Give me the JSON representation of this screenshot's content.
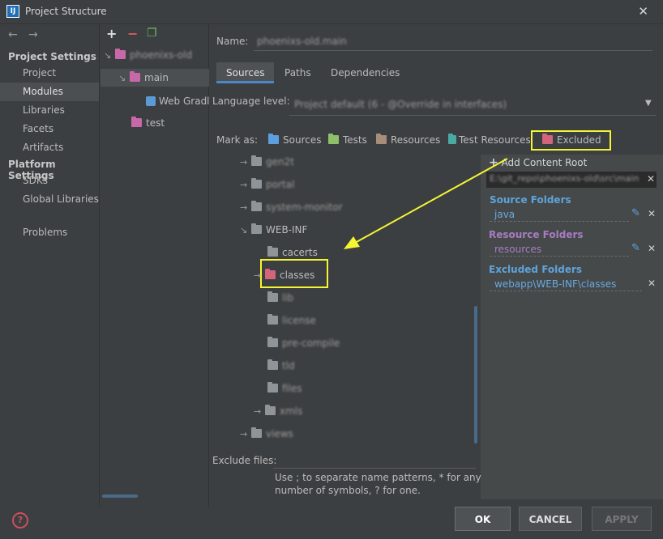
{
  "window": {
    "title": "Project Structure",
    "close_glyph": "✕",
    "icon_letter": "IJ"
  },
  "nav": {
    "back": "←",
    "forward": "→",
    "project_settings_header": "Project Settings",
    "project_items": [
      "Project",
      "Modules",
      "Libraries",
      "Facets",
      "Artifacts"
    ],
    "platform_settings_header": "Platform Settings",
    "platform_items": [
      "SDKs",
      "Global Libraries"
    ],
    "problems": "Problems"
  },
  "module_toolbar": {
    "add": "+",
    "remove": "−",
    "copy": "❐"
  },
  "module_tree": {
    "root": "phoenixs-old",
    "main": "main",
    "web_gradle": "Web Gradl",
    "test": "test"
  },
  "main": {
    "name_label": "Name:",
    "name_value": "phoenixs-old.main",
    "tabs": [
      "Sources",
      "Paths",
      "Dependencies"
    ],
    "language_level_label": "Language level:",
    "language_level_value": "Project default (6 - @Override in interfaces)",
    "mark_as_label": "Mark as:",
    "mark_as": [
      "Sources",
      "Tests",
      "Resources",
      "Test Resources",
      "Excluded"
    ],
    "dirs": [
      "gen2t",
      "portal",
      "system-monitor",
      "WEB-INF",
      "cacerts",
      "classes",
      "lib",
      "license",
      "pre-compile",
      "tld",
      "files",
      "xmls",
      "views"
    ],
    "exclude_files_label": "Exclude files:",
    "exclude_hint_1": "Use ; to separate name patterns, * for any",
    "exclude_hint_2": "number of symbols, ? for one."
  },
  "roots_panel": {
    "add_content_root": "Add Content Root",
    "content_root_path": "E:\\git_repo\\phoenixs-old\\src\\main",
    "source_folders_header": "Source Folders",
    "source_folders": [
      "java"
    ],
    "resource_folders_header": "Resource Folders",
    "resource_folders": [
      "resources"
    ],
    "excluded_folders_header": "Excluded Folders",
    "excluded_folders": [
      "webapp\\WEB-INF\\classes"
    ]
  },
  "buttons": {
    "help": "?",
    "ok": "OK",
    "cancel": "CANCEL",
    "apply": "APPLY"
  },
  "colors": {
    "accent": "#4a88c7",
    "source_header": "#5fa3db",
    "resource_header": "#a97bc2",
    "excluded_header": "#5fa3db",
    "annotation": "#f5f531"
  }
}
